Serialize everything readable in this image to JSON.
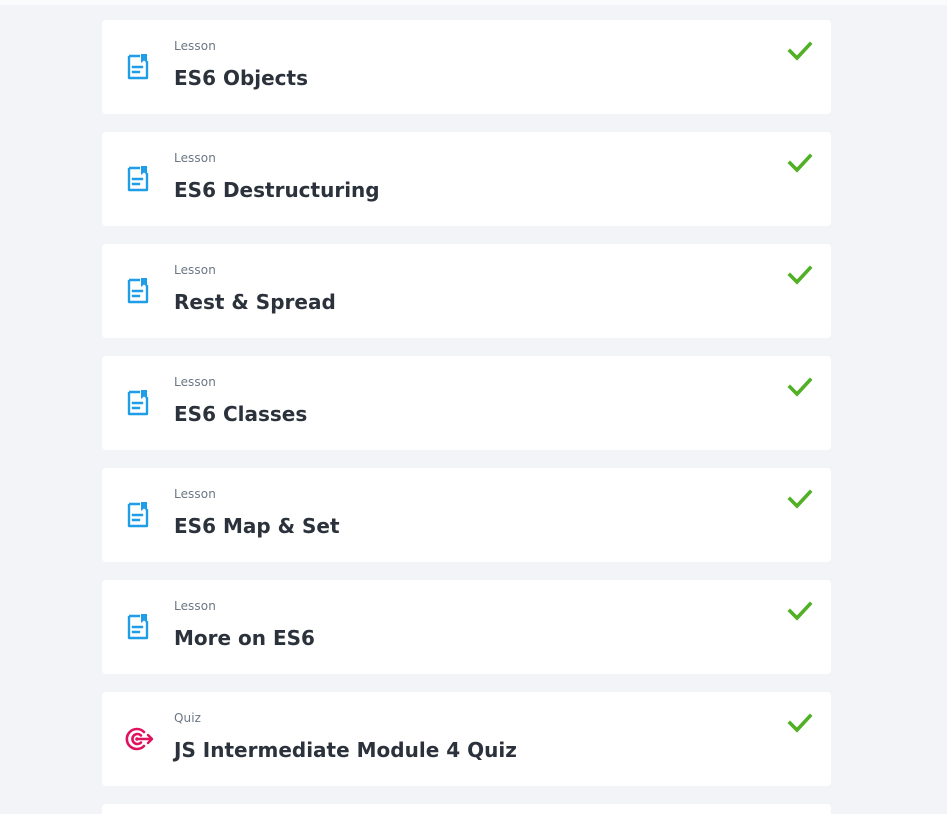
{
  "colors": {
    "page_background": "#f2f4f7",
    "card_background": "#ffffff",
    "lesson_icon": "#1f9ee8",
    "quiz_icon": "#e0115f",
    "check": "#52b026",
    "title_text": "#2b323b",
    "type_text": "#6b7785"
  },
  "items": [
    {
      "type": "Lesson",
      "title": "ES6 Objects",
      "icon": "lesson-document-icon",
      "completed": true
    },
    {
      "type": "Lesson",
      "title": "ES6 Destructuring",
      "icon": "lesson-document-icon",
      "completed": true
    },
    {
      "type": "Lesson",
      "title": "Rest & Spread",
      "icon": "lesson-document-icon",
      "completed": true
    },
    {
      "type": "Lesson",
      "title": "ES6 Classes",
      "icon": "lesson-document-icon",
      "completed": true
    },
    {
      "type": "Lesson",
      "title": "ES6 Map & Set",
      "icon": "lesson-document-icon",
      "completed": true
    },
    {
      "type": "Lesson",
      "title": "More on ES6",
      "icon": "lesson-document-icon",
      "completed": true
    },
    {
      "type": "Quiz",
      "title": "JS Intermediate Module 4 Quiz",
      "icon": "quiz-target-icon",
      "completed": true
    }
  ]
}
